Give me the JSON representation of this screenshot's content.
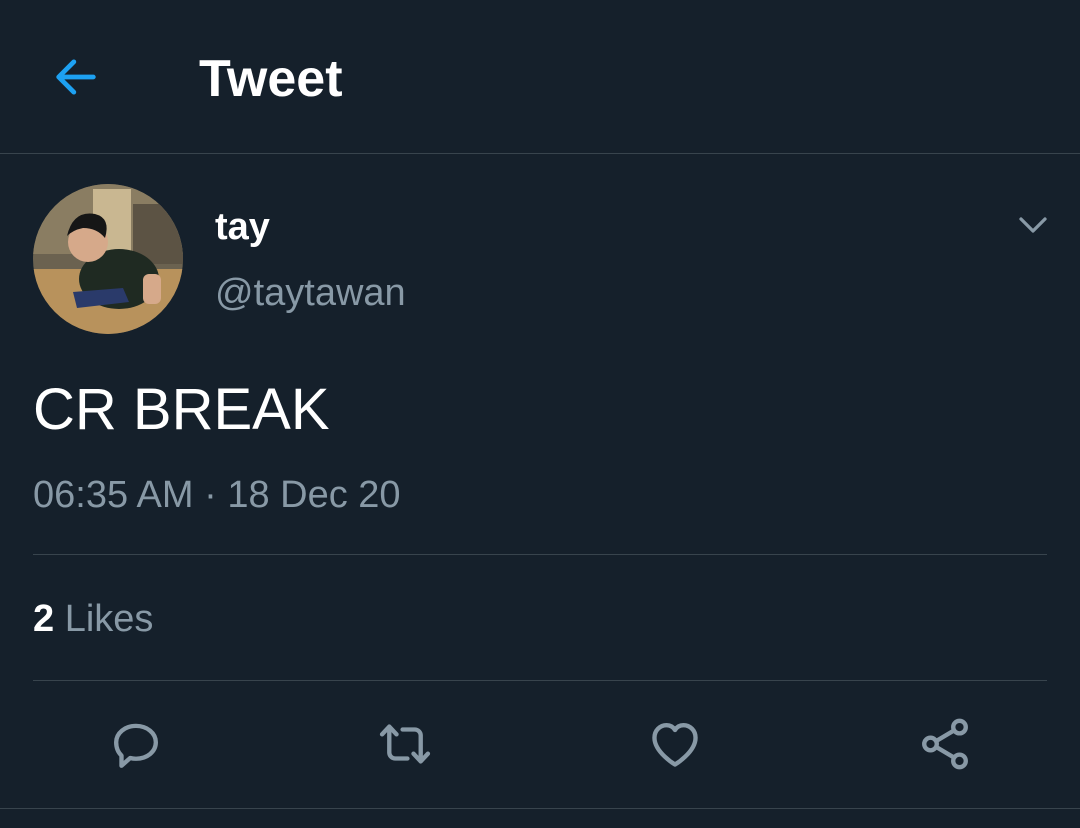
{
  "header": {
    "title": "Tweet",
    "back_icon": "arrow-left-icon"
  },
  "tweet": {
    "display_name": "tay",
    "handle": "@taytawan",
    "text": "CR BREAK",
    "time": "06:35 AM",
    "separator": " · ",
    "date": "18 Dec 20",
    "likes_count": "2",
    "likes_label": " Likes",
    "menu_icon": "chevron-down-icon"
  },
  "actions": [
    {
      "name": "reply",
      "icon": "reply-icon"
    },
    {
      "name": "retweet",
      "icon": "retweet-icon"
    },
    {
      "name": "like",
      "icon": "heart-icon"
    },
    {
      "name": "share",
      "icon": "share-icon"
    }
  ],
  "colors": {
    "background": "#15202b",
    "accent": "#1da1f2",
    "secondary_text": "#8899a6",
    "divider": "#38444d"
  }
}
